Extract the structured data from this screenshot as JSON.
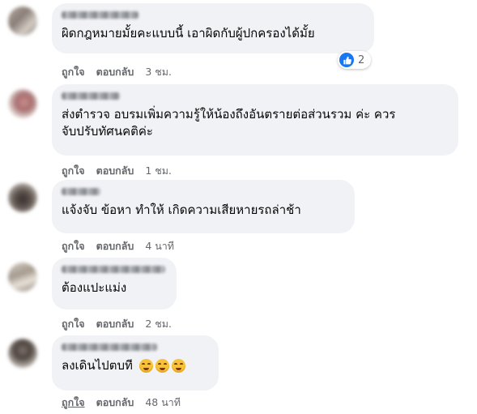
{
  "comments": [
    {
      "text_lines": [
        "ผิดกฎหมายมั้ยคะแบบนี้ เอาผิดกับผู้ปกครองได้มั้ย"
      ],
      "like": "ถูกใจ",
      "reply": "ตอบกลับ",
      "time": "3 ชม.",
      "reaction_count": "2",
      "reaction_icon": "thumbs-up-icon"
    },
    {
      "text_lines": [
        "ส่งตำรวจ อบรมเพิ่มความรู้ให้น้องถึงอันตรายต่อส่วนรวม ค่ะ ควร",
        "จับปรับทัศนคติค่ะ"
      ],
      "like": "ถูกใจ",
      "reply": "ตอบกลับ",
      "time": "1 ชม."
    },
    {
      "text_lines": [
        "แจ้งจับ ข้อหา ทำให้ เกิดความเสียหายรถล่าช้า"
      ],
      "like": "ถูกใจ",
      "reply": "ตอบกลับ",
      "time": "4 นาที"
    },
    {
      "text_lines": [
        "ต้องแปะแม่ง"
      ],
      "like": "ถูกใจ",
      "reply": "ตอบกลับ",
      "time": "2 ชม."
    },
    {
      "text_lines": [
        "ลงเดินไปตบที"
      ],
      "emojis": [
        "face-with-steam-emoji",
        "face-with-steam-emoji",
        "face-with-steam-emoji"
      ],
      "like": "ถูกใจ",
      "reply": "ตอบกลับ",
      "time": "48 นาที"
    }
  ],
  "colors": {
    "bubble": "#f0f2f5",
    "meta_text": "#65676b",
    "like_blue": "#1877f2"
  }
}
